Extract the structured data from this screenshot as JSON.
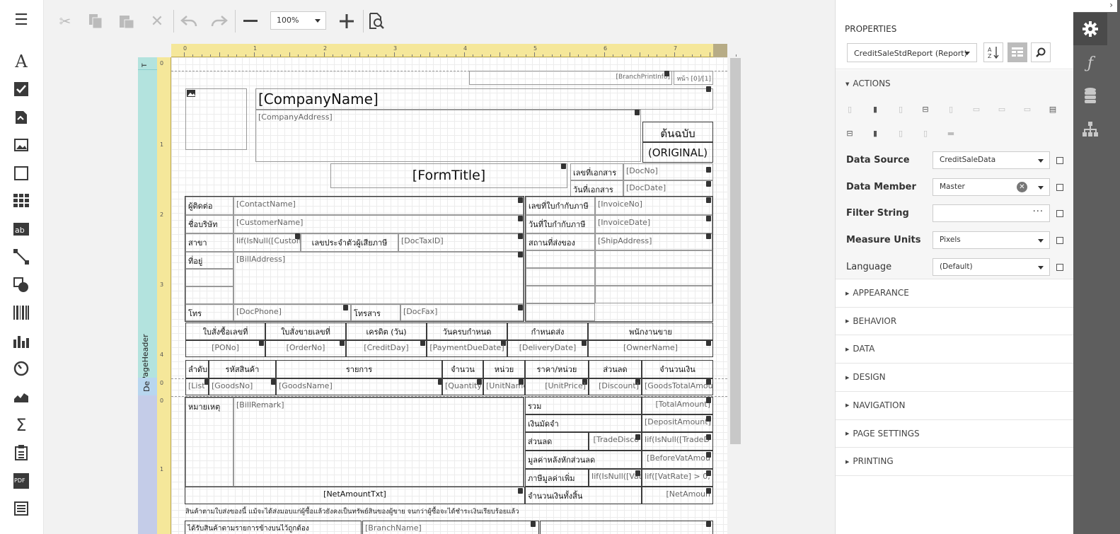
{
  "toolbar": {
    "zoom_value": "100%",
    "buttons": [
      "hamburger-menu",
      "cut",
      "copy",
      "paste",
      "delete",
      "undo",
      "redo",
      "zoom-out",
      "zoom-in",
      "preview"
    ]
  },
  "toolbox": {
    "items": [
      "label",
      "checkbox",
      "rich-text",
      "picture",
      "panel",
      "table",
      "character-comb",
      "line",
      "shape",
      "barcode",
      "chart",
      "gauge",
      "sparkline",
      "summary",
      "page-info",
      "pdf-content",
      "table-of-contents"
    ]
  },
  "ruler": {
    "ticks": [
      "0",
      "1",
      "2",
      "3",
      "4",
      "5",
      "6",
      "7"
    ],
    "v_ticks_1": [
      "1",
      "2",
      "3",
      "4"
    ],
    "v_ticks_2": [
      "1"
    ]
  },
  "bands": {
    "page_header": "PageHeader",
    "detail": "De",
    "top": "T"
  },
  "report": {
    "branch_print_info": "[BranchPrintInfo]",
    "page_number": "หน้า [0]/[1]",
    "company_name": "[CompanyName]",
    "company_address": "[CompanyAddress]",
    "original_th": "ต้นฉบับ",
    "original_en": "(ORIGINAL)",
    "form_title": "[FormTitle]",
    "doc_no_label": "เลขที่เอกสาร",
    "doc_no": "[DocNo]",
    "doc_date_label": "วันที่เอกสาร",
    "doc_date": "[DocDate]",
    "contact_label": "ผู้ติดต่อ",
    "contact_name": "[ContactName]",
    "customer_label": "ชื่อบริษัท",
    "customer_name": "[CustomerName]",
    "branch_label": "สาขา",
    "branch_expr": "Iif(IsNull([Custom",
    "tax_id_label": "เลขประจำตัวผู้เสียภาษี",
    "doc_tax_id": "[DocTaxID]",
    "address_label": "ที่อยู่",
    "bill_address": "[BillAddress]",
    "phone_label": "โทร",
    "doc_phone": "[DocPhone]",
    "fax_label": "โทรสาร",
    "doc_fax": "[DocFax]",
    "invoice_no_label": "เลขที่ใบกำกับภาษี",
    "invoice_no": "[InvoiceNo]",
    "invoice_date_label": "วันที่ใบกำกับภาษี",
    "invoice_date": "[InvoiceDate]",
    "ship_label": "สถานที่ส่งของ",
    "ship_address": "[ShipAddress]",
    "info_headers": [
      "ใบสั่งซื้อเลขที่",
      "ใบสั่งขายเลขที่",
      "เครดิต (วัน)",
      "วันครบกำหนด",
      "กำหนดส่ง",
      "พนักงานขาย"
    ],
    "info_values": [
      "[PONo]",
      "[OrderNo]",
      "[CreditDay]",
      "[PaymentDueDate]",
      "[DeliveryDate]",
      "[OwnerName]"
    ],
    "detail_headers": [
      "ลำดับ",
      "รหัสสินค้า",
      "รายการ",
      "จำนวน",
      "หน่วย",
      "ราคา/หน่วย",
      "ส่วนลด",
      "จำนวนเงิน"
    ],
    "detail_values": [
      "[List",
      "[GoodsNo]",
      "[GoodsName]",
      "[Quantity",
      "[UnitName",
      "[UnitPrice]",
      "[Discount]",
      "[GoodsTotalAmou"
    ],
    "remark_label": "หมายเหตุ",
    "bill_remark": "[BillRemark]",
    "total_label": "รวม",
    "total_amount": "[TotalAmount]",
    "deposit_label": "เงินมัดจำ",
    "deposit_amount": "[DepositAmount]",
    "discount_label": "ส่วนลด",
    "trade_discount": "[TradeDisco",
    "trade_discount_expr": "Iif(IsNull([TradeD",
    "before_vat_label": "มูลค่าหลังหักส่วนลด",
    "before_vat_amount": "[BeforeVatAmou",
    "vat_label": "ภาษีมูลค่าเพิ่ม",
    "vat_expr1": "Iif(IsNull([Vat",
    "vat_expr2": "Iif([VatRate] > 0,",
    "net_amount_txt": "[NetAmountTxt]",
    "net_label": "จำนวนเงินทั้งสิ้น",
    "net_amount": "[NetAmoun",
    "footer_note": "สินค้าตามใบส่งของนี้ แม้จะได้ส่งมอบแก่ผู้ซื้อแล้วยังคงเป็นทรัพย์สินของผู้ขาย จนกว่าผู้ซื้อจะได้ชำระเงินเรียบร้อยแล้ว",
    "footer_left": "ได้รับสินค้าตามรายการข้างบนไว้ถูกต้อง",
    "footer_branch": "[BranchName]"
  },
  "properties": {
    "title": "PROPERTIES",
    "object": "CreditSaleStdReport (Report)",
    "actions_label": "ACTIONS",
    "rows": [
      {
        "label": "Data Source",
        "value": "CreditSaleData",
        "bold": true
      },
      {
        "label": "Data Member",
        "value": "Master",
        "bold": true
      },
      {
        "label": "Filter String",
        "value": "",
        "bold": true
      },
      {
        "label": "Measure Units",
        "value": "Pixels",
        "bold": true
      },
      {
        "label": "Language",
        "value": "(Default)",
        "bold": false
      }
    ],
    "sections": [
      "APPEARANCE",
      "BEHAVIOR",
      "DATA",
      "DESIGN",
      "NAVIGATION",
      "PAGE SETTINGS",
      "PRINTING"
    ]
  },
  "right_tabs": [
    "properties-gear",
    "expressions",
    "field-list",
    "report-explorer"
  ]
}
